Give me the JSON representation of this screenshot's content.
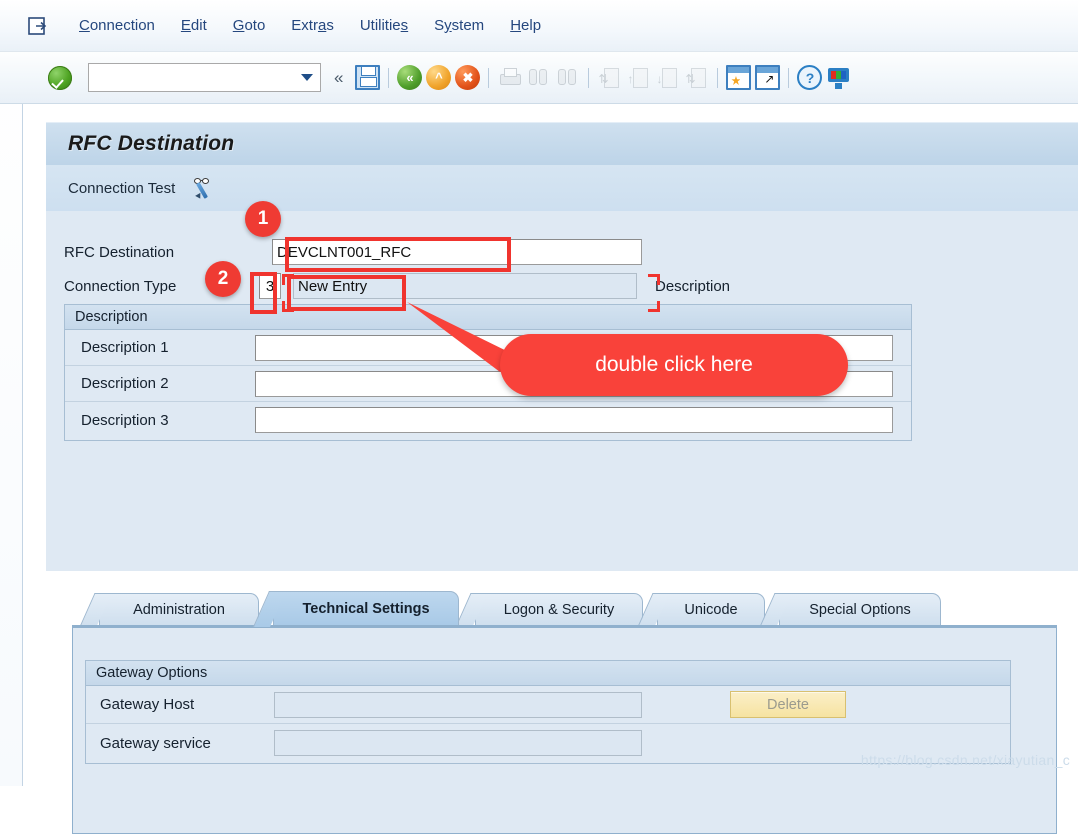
{
  "window": {
    "title": "RFC Destination"
  },
  "menubar": {
    "system_icon": "sap-system-menu-icon",
    "items": [
      {
        "label": "Connection",
        "accel": "C"
      },
      {
        "label": "Edit",
        "accel": "E"
      },
      {
        "label": "Goto",
        "accel": "G"
      },
      {
        "label": "Extras",
        "accel": "a"
      },
      {
        "label": "Utilities",
        "accel": "s"
      },
      {
        "label": "System",
        "accel": "y"
      },
      {
        "label": "Help",
        "accel": "H"
      }
    ]
  },
  "toolbar": {
    "enter_icon": "green-check-enter-icon",
    "command_field_value": "",
    "command_field_placeholder": "",
    "dropdown_icon": "chevron-down-icon",
    "collapse_icon": "double-chevron-left-icon",
    "buttons": [
      {
        "name": "save-icon",
        "label": "Save"
      },
      {
        "name": "back-icon",
        "label": "Back"
      },
      {
        "name": "exit-icon",
        "label": "Exit"
      },
      {
        "name": "cancel-icon",
        "label": "Cancel"
      },
      {
        "name": "print-icon",
        "label": "Print"
      },
      {
        "name": "find-icon",
        "label": "Find"
      },
      {
        "name": "find-next-icon",
        "label": "Find Next"
      },
      {
        "name": "first-page-icon",
        "label": "First Page"
      },
      {
        "name": "previous-page-icon",
        "label": "Previous Page"
      },
      {
        "name": "next-page-icon",
        "label": "Next Page"
      },
      {
        "name": "last-page-icon",
        "label": "Last Page"
      },
      {
        "name": "create-session-icon",
        "label": "Create New Session"
      },
      {
        "name": "create-shortcut-icon",
        "label": "Create Shortcut"
      },
      {
        "name": "help-icon",
        "label": "Help"
      },
      {
        "name": "customize-layout-icon",
        "label": "Customize Local Layout"
      }
    ]
  },
  "actions": {
    "connection_test_label": "Connection Test",
    "connection_test_icon": "glasses-pencil-icon"
  },
  "form": {
    "rfc_destination_label": "RFC Destination",
    "rfc_destination_value": "DEVCLNT001_RFC",
    "connection_type_label": "Connection Type",
    "connection_type_value": "3",
    "connection_type_text": "New Entry",
    "description_side_label": "Description"
  },
  "description_group": {
    "title": "Description",
    "rows": [
      {
        "label": "Description 1",
        "value": ""
      },
      {
        "label": "Description 2",
        "value": ""
      },
      {
        "label": "Description 3",
        "value": ""
      }
    ]
  },
  "tabs": [
    {
      "label": "Administration",
      "active": false
    },
    {
      "label": "Technical Settings",
      "active": true
    },
    {
      "label": "Logon & Security",
      "active": false
    },
    {
      "label": "Unicode",
      "active": false
    },
    {
      "label": "Special Options",
      "active": false
    }
  ],
  "gateway_group": {
    "title": "Gateway Options",
    "rows": [
      {
        "label": "Gateway Host",
        "value": ""
      },
      {
        "label": "Gateway service",
        "value": ""
      }
    ],
    "delete_button": "Delete"
  },
  "annotations": {
    "badge_1": "1",
    "badge_2": "2",
    "callout_text": "double click here"
  },
  "watermark": "https://blog.csdn.net/xiayutian_c",
  "colors": {
    "accent_red": "#f9423a",
    "panel_blue": "#dfe9f3",
    "title_blue": "#c6d9ea",
    "button_yellow": "#f6e3a1"
  }
}
